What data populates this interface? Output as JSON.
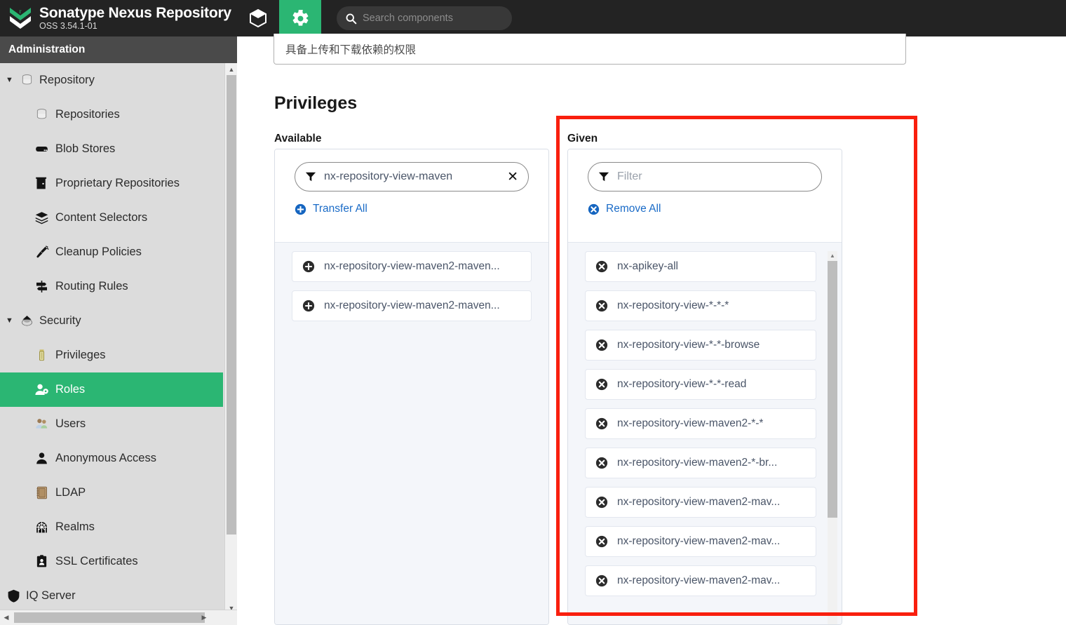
{
  "header": {
    "brand_title": "Sonatype Nexus Repository",
    "brand_subtitle": "OSS 3.54.1-01",
    "logo_icon": "nexus-logo-icon",
    "nav": [
      {
        "icon": "cube-icon",
        "name": "browse",
        "active": false
      },
      {
        "icon": "gear-icon",
        "name": "administration",
        "active": true
      }
    ],
    "search": {
      "icon": "search-icon",
      "placeholder": "Search components",
      "value": ""
    }
  },
  "sidebar": {
    "title": "Administration",
    "items": [
      {
        "label": "Repository",
        "icon": "database-icon",
        "level": "group",
        "caret": "▼",
        "selected": false
      },
      {
        "label": "Repositories",
        "icon": "database-icon",
        "level": "child",
        "selected": false
      },
      {
        "label": "Blob Stores",
        "icon": "blob-store-icon",
        "level": "child",
        "selected": false
      },
      {
        "label": "Proprietary Repositories",
        "icon": "door-icon",
        "level": "child",
        "selected": false
      },
      {
        "label": "Content Selectors",
        "icon": "layers-icon",
        "level": "child",
        "selected": false
      },
      {
        "label": "Cleanup Policies",
        "icon": "broom-icon",
        "level": "child",
        "selected": false
      },
      {
        "label": "Routing Rules",
        "icon": "signpost-icon",
        "level": "child",
        "selected": false
      },
      {
        "label": "Security",
        "icon": "security-shield-icon",
        "level": "group",
        "caret": "▼",
        "selected": false
      },
      {
        "label": "Privileges",
        "icon": "medal-icon",
        "level": "child",
        "selected": false
      },
      {
        "label": "Roles",
        "icon": "roles-icon",
        "level": "child",
        "selected": true
      },
      {
        "label": "Users",
        "icon": "users-icon",
        "level": "child",
        "selected": false
      },
      {
        "label": "Anonymous Access",
        "icon": "person-icon",
        "level": "child",
        "selected": false
      },
      {
        "label": "LDAP",
        "icon": "address-book-icon",
        "level": "child",
        "selected": false
      },
      {
        "label": "Realms",
        "icon": "realms-icon",
        "level": "child",
        "selected": false
      },
      {
        "label": "SSL Certificates",
        "icon": "id-badge-icon",
        "level": "child",
        "selected": false
      },
      {
        "label": "IQ Server",
        "icon": "shield-icon",
        "level": "topgroup",
        "selected": false
      }
    ],
    "scroll": {
      "up_arrow": "▲",
      "down_arrow": "▼",
      "left_arrow": "◀",
      "right_arrow": "▶"
    }
  },
  "main": {
    "description_value": "具备上传和下载依赖的权限",
    "section_title": "Privileges",
    "available": {
      "label": "Available",
      "filter": {
        "icon": "filter-icon",
        "value": "nx-repository-view-maven",
        "placeholder": "Filter",
        "clear_icon": "close-icon",
        "clear_glyph": "✕"
      },
      "action": {
        "label": "Transfer All",
        "icon": "plus-circle-icon"
      },
      "items": [
        {
          "label": "nx-repository-view-maven2-maven...",
          "icon": "plus-circle-icon"
        },
        {
          "label": "nx-repository-view-maven2-maven...",
          "icon": "plus-circle-icon"
        }
      ]
    },
    "given": {
      "label": "Given",
      "filter": {
        "icon": "filter-icon",
        "value": "",
        "placeholder": "Filter"
      },
      "action": {
        "label": "Remove All",
        "icon": "x-circle-icon"
      },
      "items": [
        {
          "label": "nx-apikey-all",
          "icon": "x-circle-icon"
        },
        {
          "label": "nx-repository-view-*-*-*",
          "icon": "x-circle-icon"
        },
        {
          "label": "nx-repository-view-*-*-browse",
          "icon": "x-circle-icon"
        },
        {
          "label": "nx-repository-view-*-*-read",
          "icon": "x-circle-icon"
        },
        {
          "label": "nx-repository-view-maven2-*-*",
          "icon": "x-circle-icon"
        },
        {
          "label": "nx-repository-view-maven2-*-br...",
          "icon": "x-circle-icon"
        },
        {
          "label": "nx-repository-view-maven2-mav...",
          "icon": "x-circle-icon"
        },
        {
          "label": "nx-repository-view-maven2-mav...",
          "icon": "x-circle-icon"
        },
        {
          "label": "nx-repository-view-maven2-mav...",
          "icon": "x-circle-icon"
        }
      ],
      "scroll": {
        "up_arrow": "▲"
      }
    }
  },
  "annotation": {
    "name": "highlight-rectangle",
    "color": "#f91f0e"
  },
  "colors": {
    "accent_green": "#2bb673",
    "header_dark": "#232323",
    "admin_bar": "#4a4a4a",
    "sidebar_bg": "#dcdcdc",
    "link_blue": "#1a6bc7",
    "list_bg": "#f4f6fa",
    "annotation_red": "#f91f0e"
  }
}
